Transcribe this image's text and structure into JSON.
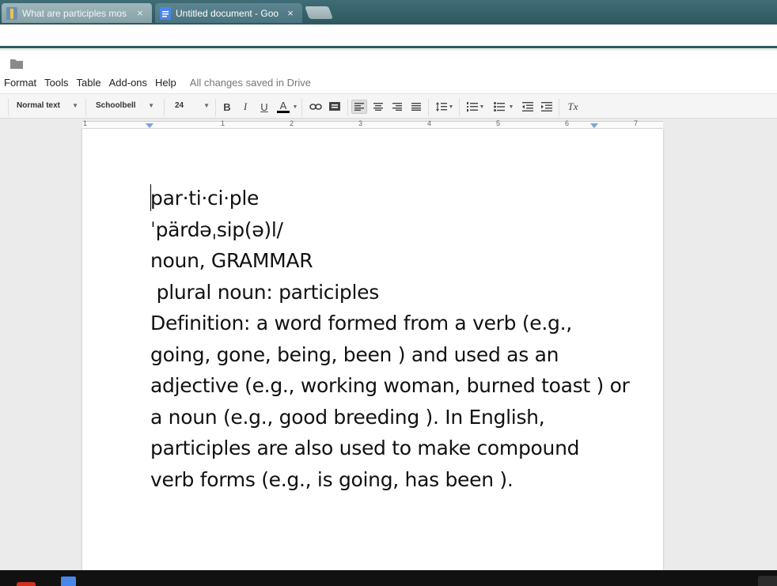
{
  "browser": {
    "tabs": [
      {
        "title": "What are participles mos",
        "active": false
      },
      {
        "title": "Untitled document - Goo",
        "active": true
      }
    ],
    "close_glyph": "×"
  },
  "docs": {
    "menu": [
      "Format",
      "Tools",
      "Table",
      "Add-ons",
      "Help"
    ],
    "save_status": "All changes saved in Drive"
  },
  "toolbar": {
    "style": "Normal text",
    "font": "Schoolbell",
    "font_size": "24",
    "bold": "B",
    "italic": "I",
    "underline": "U",
    "text_color": "A",
    "text_color_value": "#000000",
    "clear_format": "Tx"
  },
  "ruler": {
    "labels": [
      "1",
      "1",
      "2",
      "3",
      "4",
      "5",
      "6",
      "7"
    ]
  },
  "document": {
    "lines": [
      "par·ti·ci·ple",
      "ˈpärdəˌsip(ə)l/",
      "noun, GRAMMAR",
      " plural noun: participles",
      "Definition: a word formed from a verb (e.g.,",
      "going, gone, being, been ) and used as an",
      "adjective (e.g., working woman, burned toast ) or",
      "a noun (e.g., good breeding ). In English,",
      "participles are also used to make compound",
      "verb forms (e.g., is going, has been )."
    ]
  },
  "colors": {
    "tabstrip": "#3f6c76",
    "accent_blue": "#4a86e8",
    "taskbar": "#111111"
  }
}
